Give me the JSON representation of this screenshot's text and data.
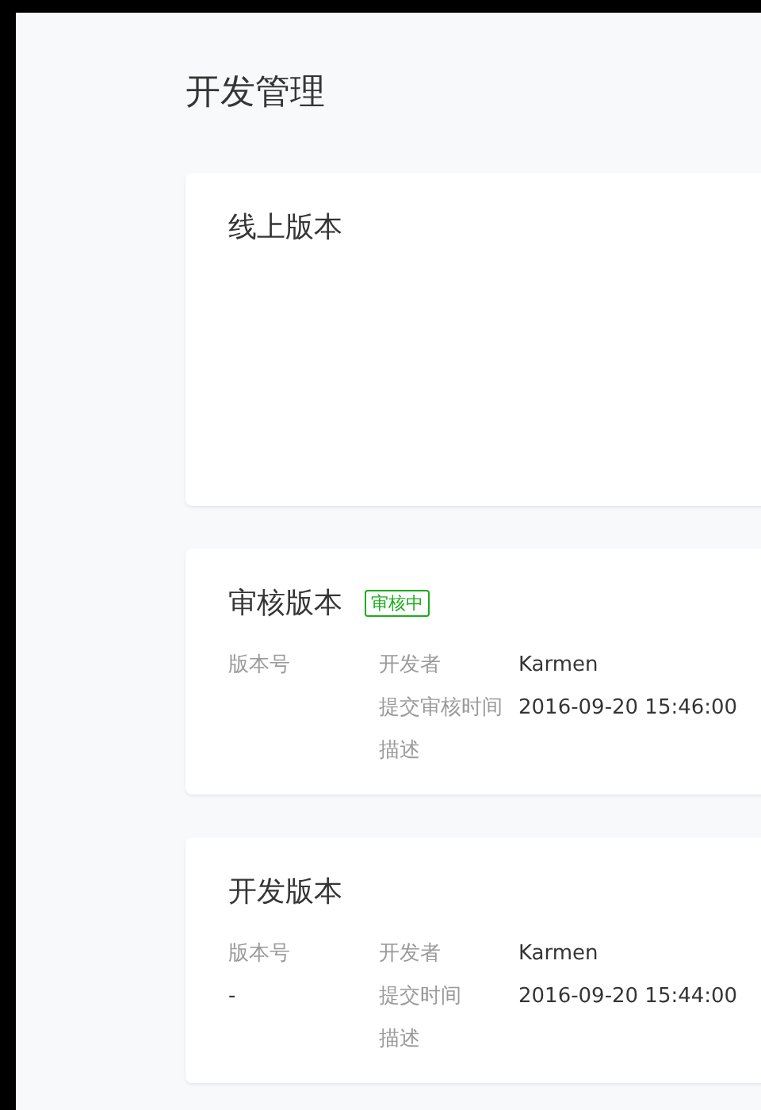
{
  "page_title": "开发管理",
  "sections": [
    {
      "title": "线上版本"
    },
    {
      "title": "审核版本",
      "badge": "审核中",
      "version_label": "版本号",
      "fields": [
        {
          "label": "开发者",
          "value": "Karmen"
        },
        {
          "label": "提交审核时间",
          "value": "2016-09-20 15:46:00"
        },
        {
          "label": "描述"
        }
      ]
    },
    {
      "title": "开发版本",
      "version_label": "版本号",
      "version_value": "-",
      "fields": [
        {
          "label": "开发者",
          "value": "Karmen"
        },
        {
          "label": "提交时间",
          "value": "2016-09-20 15:44:00"
        },
        {
          "label": "描述"
        }
      ]
    }
  ]
}
